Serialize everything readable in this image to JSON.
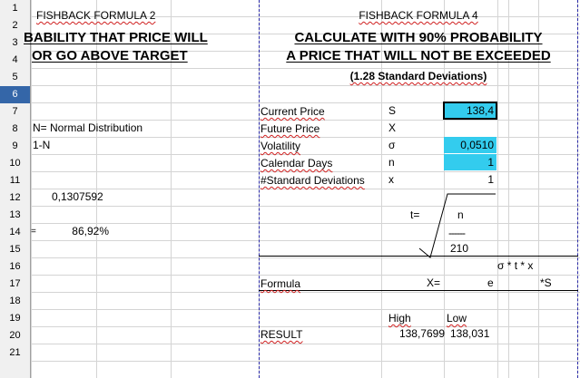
{
  "rows": [
    "1",
    "2",
    "3",
    "4",
    "5",
    "6",
    "7",
    "8",
    "9",
    "10",
    "11",
    "12",
    "13",
    "14",
    "15",
    "16",
    "17",
    "18",
    "19",
    "20",
    "21"
  ],
  "selected_row": "6",
  "left": {
    "title": "FISHBACK FORMULA 2",
    "heading1": "BABILITY THAT PRICE WILL",
    "heading2": "OR GO ABOVE TARGET",
    "n_label": "N= Normal Distribution",
    "one_minus_n": "1-N",
    "value1": "0,1307592",
    "eq": "=",
    "result_pct": "86,92%"
  },
  "right": {
    "title": "FISHBACK FORMULA 4",
    "heading1": "CALCULATE WITH 90% PROBABILITY",
    "heading2": "A PRICE THAT WILL NOT BE EXCEEDED",
    "subheading": "(1.28 Standard Deviations)",
    "inputs": [
      {
        "label": "Current Price",
        "sym": "S",
        "value": "138,4"
      },
      {
        "label": "Future Price",
        "sym": "X",
        "value": ""
      },
      {
        "label": "Volatility",
        "sym": "σ",
        "value": "0,0510"
      },
      {
        "label": "Calendar Days",
        "sym": "n",
        "value": "1"
      },
      {
        "label": "#Standard Deviations",
        "sym": "x",
        "value": "1"
      }
    ],
    "t_eq": "t=",
    "t_num": "n",
    "t_line": "------",
    "t_den": "210",
    "exponent": "σ * t * x",
    "formula_label": "Formula",
    "x_eq": "X=",
    "e_sym": "e",
    "s_mult": "*S",
    "high_label": "High",
    "low_label": "Low",
    "result_label": "RESULT",
    "high_value": "138,7699",
    "low_value": "138,031"
  }
}
